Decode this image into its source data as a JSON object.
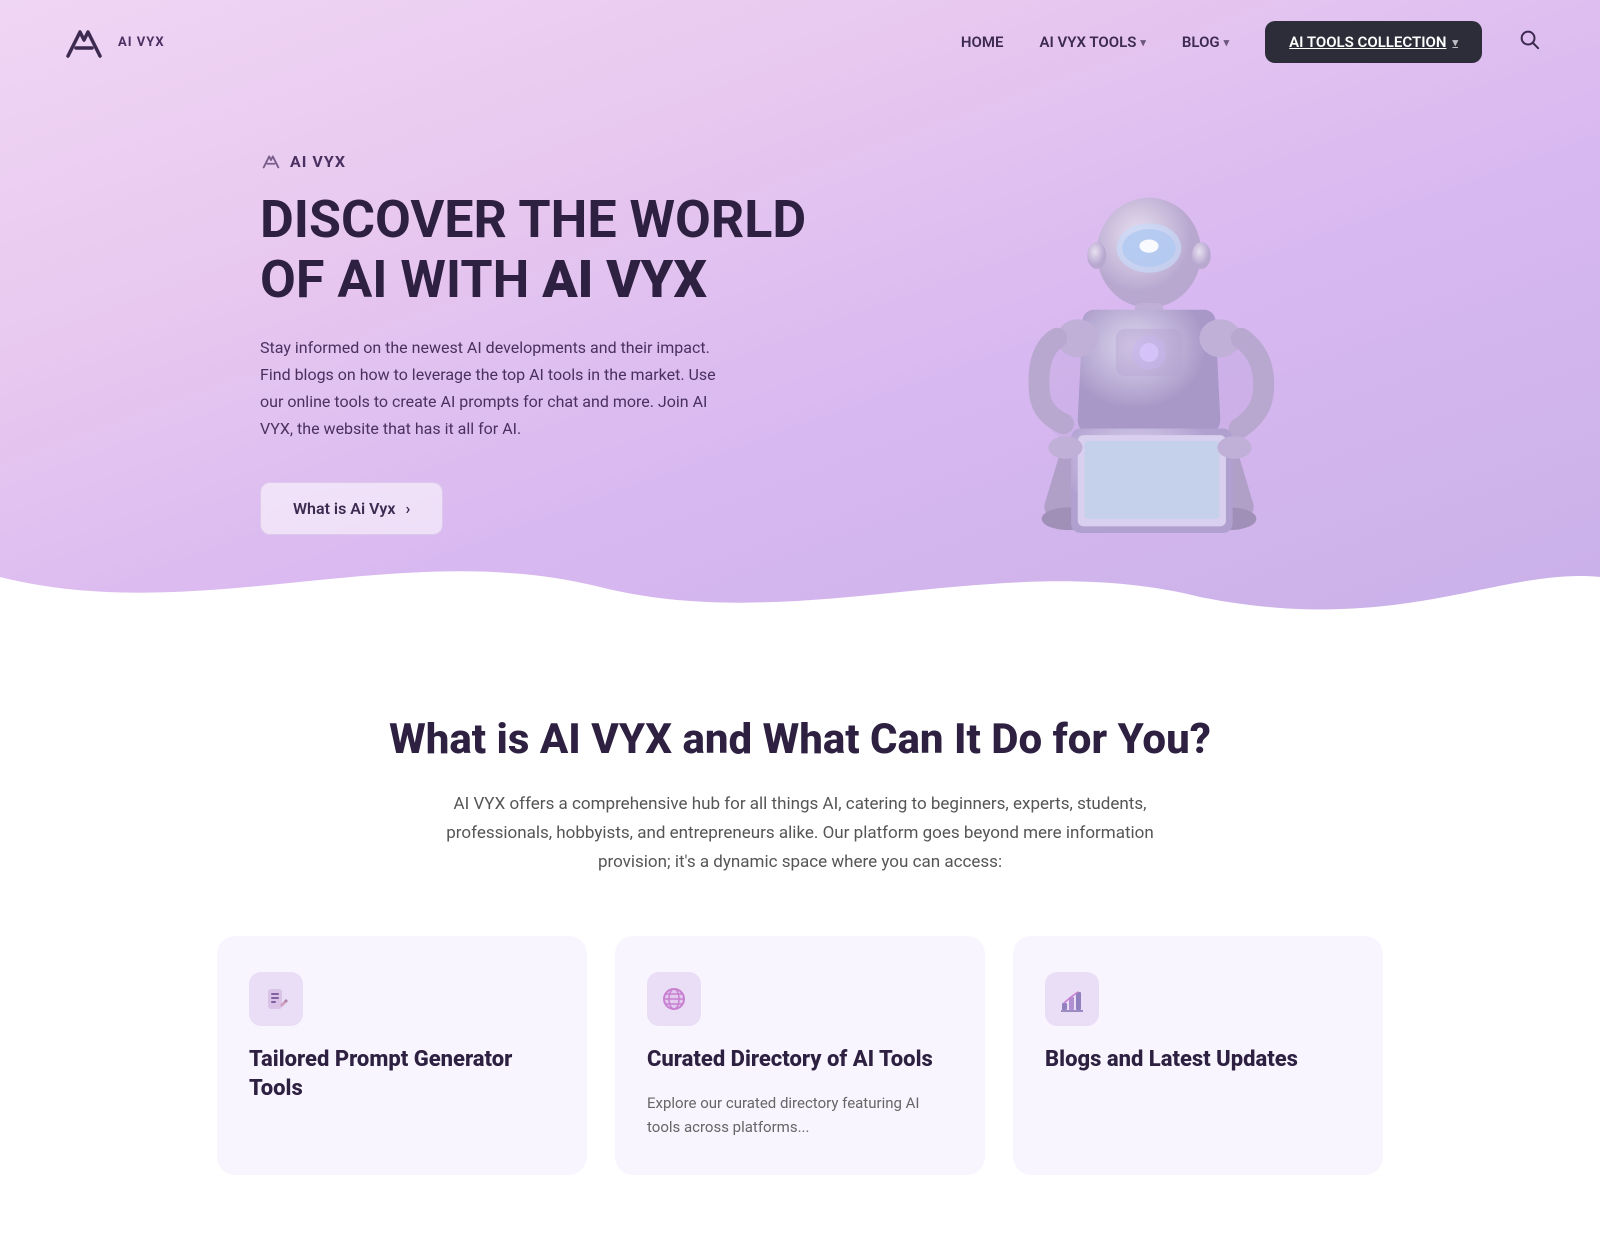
{
  "nav": {
    "logo_text": "AI VYX",
    "links": [
      {
        "label": "HOME",
        "active": false
      },
      {
        "label": "AI VYX TOOLS",
        "active": false,
        "has_dropdown": true
      },
      {
        "label": "BLOG",
        "active": false,
        "has_dropdown": true
      }
    ],
    "cta_label": "AI TOOLS COLLECTION",
    "search_label": "search"
  },
  "hero": {
    "brand_label": "AI VYX",
    "title_part1": "DISCOVER THE WORLD OF AI WITH ",
    "title_bold": "AI VYX",
    "description": "Stay informed on the newest AI developments and their impact. Find blogs on how to leverage the top AI tools in the market. Use our online tools to create AI prompts for chat and more. Join AI VYX, the website that has it all for AI.",
    "cta_label": "What is Ai Vyx"
  },
  "section": {
    "title": "What is AI VYX and What Can It Do for You?",
    "description": "AI VYX offers a comprehensive hub for all things AI, catering to beginners, experts, students, professionals, hobbyists, and entrepreneurs alike. Our platform goes beyond mere information provision; it's a dynamic space where you can access:"
  },
  "cards": [
    {
      "id": "prompt-tools",
      "icon": "✏️",
      "title": "Tailored Prompt Generator Tools",
      "description": ""
    },
    {
      "id": "ai-directory",
      "icon": "🔮",
      "title": "Curated Directory of AI Tools",
      "description": "Explore our curated directory featuring AI tools across platforms..."
    },
    {
      "id": "blogs",
      "icon": "📊",
      "title": "Blogs and Latest Updates",
      "description": ""
    }
  ]
}
